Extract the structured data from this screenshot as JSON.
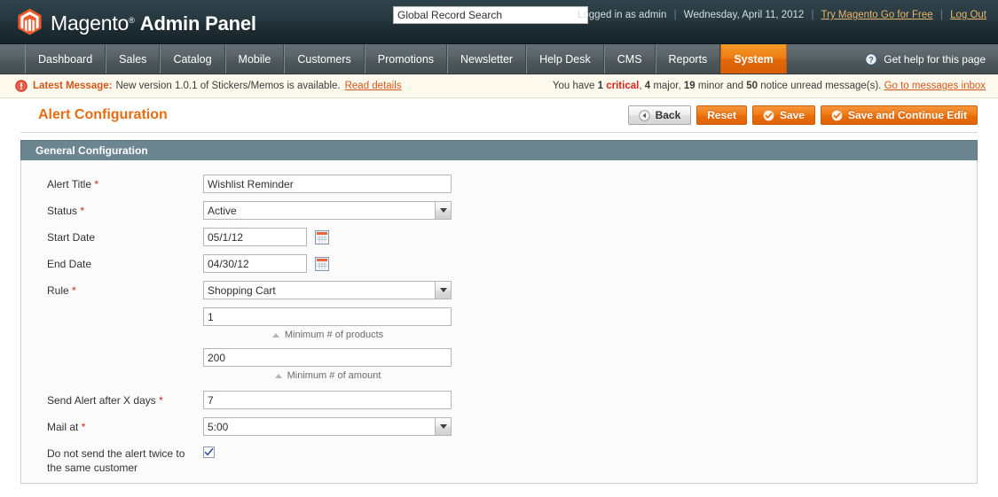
{
  "header": {
    "brand": "Magento",
    "brand_sup": "®",
    "panel": "Admin Panel",
    "search_value": "Global Record Search",
    "search_placeholder": "Global Record Search",
    "logged_in": "Logged in as admin",
    "date": "Wednesday, April 11, 2012",
    "try_link": "Try Magento Go for Free",
    "logout_link": "Log Out",
    "sep": "|"
  },
  "nav": {
    "items": [
      {
        "label": "Dashboard",
        "active": false
      },
      {
        "label": "Sales",
        "active": false
      },
      {
        "label": "Catalog",
        "active": false
      },
      {
        "label": "Mobile",
        "active": false
      },
      {
        "label": "Customers",
        "active": false
      },
      {
        "label": "Promotions",
        "active": false
      },
      {
        "label": "Newsletter",
        "active": false
      },
      {
        "label": "Help Desk",
        "active": false
      },
      {
        "label": "CMS",
        "active": false
      },
      {
        "label": "Reports",
        "active": false
      },
      {
        "label": "System",
        "active": true
      }
    ],
    "help_label": "Get help for this page",
    "help_icon": "question-circle-icon"
  },
  "message_bar": {
    "icon": "warning-icon",
    "label": "Latest Message:",
    "text": "New version 1.0.1 of Stickers/Memos is available.",
    "link": "Read details",
    "right_prefix": "You have",
    "critical_count": "1",
    "critical_word": "critical",
    "major_count": "4",
    "major_word": "major",
    "minor_count": "19",
    "minor_word": "minor",
    "notice_count": "50",
    "notice_word": "notice unread message(s).",
    "right_link": "Go to messages inbox",
    "and_word": "and",
    "comma": ","
  },
  "page": {
    "title": "Alert Configuration",
    "buttons": [
      {
        "label": "Back",
        "style": "grey",
        "icon": "back-arrow-icon"
      },
      {
        "label": "Reset",
        "style": "orange",
        "icon": ""
      },
      {
        "label": "Save",
        "style": "orange",
        "icon": "check-circle-icon"
      },
      {
        "label": "Save and Continue Edit",
        "style": "orange",
        "icon": "check-circle-icon"
      }
    ]
  },
  "form": {
    "section_title": "General Configuration",
    "fields": {
      "alert_title": {
        "label": "Alert Title",
        "required": true,
        "value": "Wishlist Reminder"
      },
      "status": {
        "label": "Status",
        "required": true,
        "value": "Active"
      },
      "start_date": {
        "label": "Start Date",
        "required": false,
        "value": "05/1/12",
        "icon": "calendar-icon"
      },
      "end_date": {
        "label": "End Date",
        "required": false,
        "value": "04/30/12",
        "icon": "calendar-icon"
      },
      "rule": {
        "label": "Rule",
        "required": true,
        "value": "Shopping Cart"
      },
      "min_products": {
        "value": "1",
        "hint": "Minimum # of products"
      },
      "min_amount": {
        "value": "200",
        "hint": "Minimum # of amount"
      },
      "send_after_days": {
        "label": "Send Alert after X days",
        "required": true,
        "value": "7"
      },
      "mail_at": {
        "label": "Mail at",
        "required": true,
        "value": "5:00"
      },
      "no_twice": {
        "label": "Do not send the alert twice to the same customer",
        "required": false,
        "checked": true
      }
    }
  },
  "colors": {
    "accent_orange": "#e96b12",
    "panel_header": "#6b8591",
    "header_dark": "#27383f",
    "nav_grey": "#5b6569",
    "critical_red": "#d4241c",
    "message_bg": "#fdf9ed"
  }
}
